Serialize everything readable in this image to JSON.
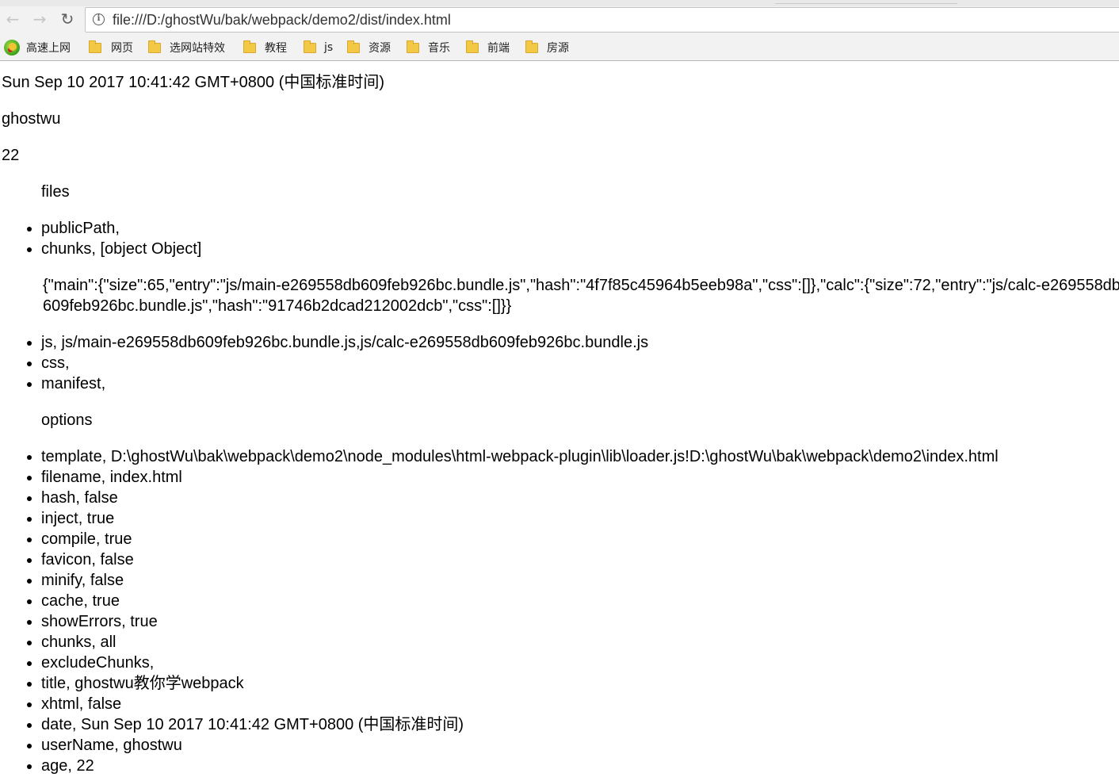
{
  "browser": {
    "url": "file:///D:/ghostWu/bak/webpack/demo2/dist/index.html",
    "bookmarks": [
      "高速上网",
      "网页",
      "选网站特效",
      "教程",
      "js",
      "资源",
      "音乐",
      "前端",
      "房源"
    ]
  },
  "page": {
    "date": "Sun Sep 10 2017 10:41:42 GMT+0800 (中国标准时间)",
    "user_name": "ghostwu",
    "age": "22",
    "files_heading": "files",
    "files_items_a": [
      "publicPath,",
      "chunks, [object Object]"
    ],
    "chunks_json": "{\"main\":{\"size\":65,\"entry\":\"js/main-e269558db609feb926bc.bundle.js\",\"hash\":\"4f7f85c45964b5eeb98a\",\"css\":[]},\"calc\":{\"size\":72,\"entry\":\"js/calc-e269558db609feb926bc.bundle.js\",\"hash\":\"91746b2dcad212002dcb\",\"css\":[]}}",
    "files_items_b": [
      "js, js/main-e269558db609feb926bc.bundle.js,js/calc-e269558db609feb926bc.bundle.js",
      "css,",
      "manifest,"
    ],
    "options_heading": "options",
    "options_items": [
      "template, D:\\ghostWu\\bak\\webpack\\demo2\\node_modules\\html-webpack-plugin\\lib\\loader.js!D:\\ghostWu\\bak\\webpack\\demo2\\index.html",
      "filename, index.html",
      "hash, false",
      "inject, true",
      "compile, true",
      "favicon, false",
      "minify, false",
      "cache, true",
      "showErrors, true",
      "chunks, all",
      "excludeChunks,",
      "title, ghostwu教你学webpack",
      "xhtml, false",
      "date, Sun Sep 10 2017 10:41:42 GMT+0800 (中国标准时间)",
      "userName, ghostwu",
      "age, 22"
    ]
  }
}
